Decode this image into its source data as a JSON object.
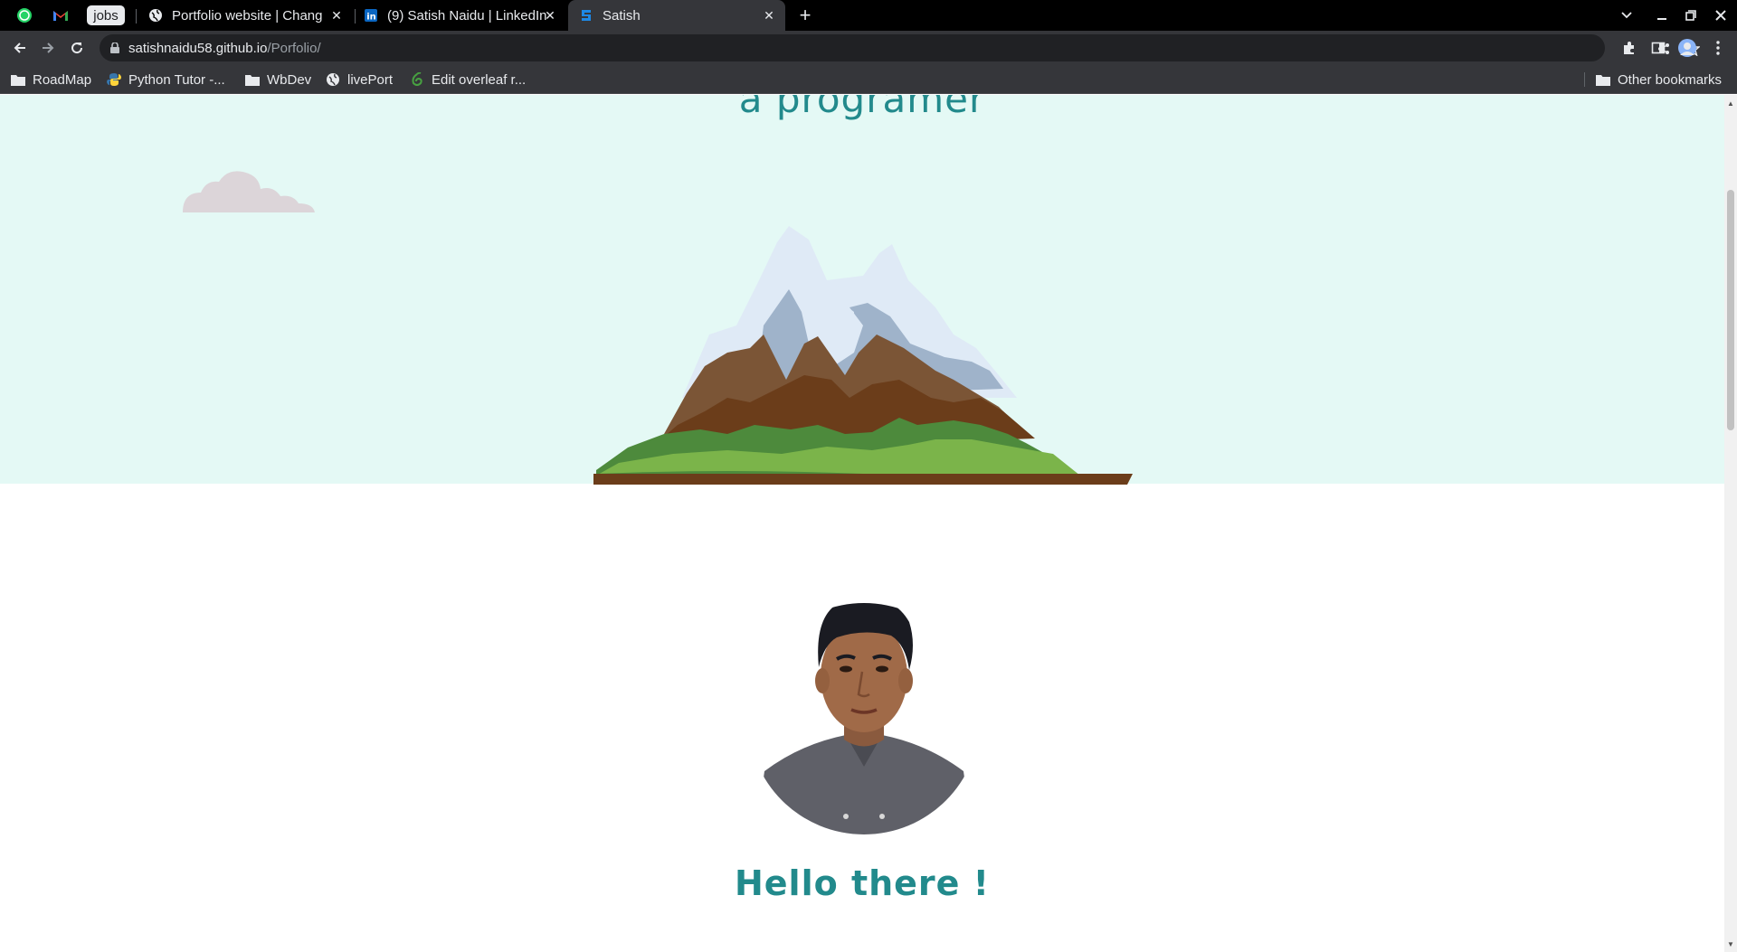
{
  "browser": {
    "pinned_tabs": [
      {
        "name": "whatsapp",
        "icon": "whatsapp-icon"
      },
      {
        "name": "gmail",
        "icon": "gmail-icon"
      },
      {
        "name": "jobs",
        "label": "jobs"
      }
    ],
    "tabs": [
      {
        "title": "Portfolio website | Chang",
        "icon": "globe-icon",
        "active": false
      },
      {
        "title": "(9) Satish Naidu | LinkedIn",
        "icon": "linkedin-icon",
        "active": false
      },
      {
        "title": "Satish",
        "icon": "site-s-icon",
        "active": true
      }
    ],
    "new_tab_label": "+",
    "url_host": "satishnaidu58.github.io",
    "url_path": "/Porfolio/",
    "bookmarks": [
      {
        "label": "RoadMap",
        "icon": "folder-icon"
      },
      {
        "label": "Python Tutor -...",
        "icon": "python-icon"
      },
      {
        "label": "WbDev",
        "icon": "folder-icon"
      },
      {
        "label": "livePort",
        "icon": "globe-icon"
      },
      {
        "label": "Edit overleaf r...",
        "icon": "overleaf-icon"
      }
    ],
    "other_bookmarks": "Other bookmarks"
  },
  "page": {
    "hero_subtitle": "a programer",
    "greeting": "Hello there !"
  },
  "colors": {
    "hero_bg": "#e4f9f5",
    "accent_text": "#228a8c",
    "cloud": "#dcd5d9"
  }
}
